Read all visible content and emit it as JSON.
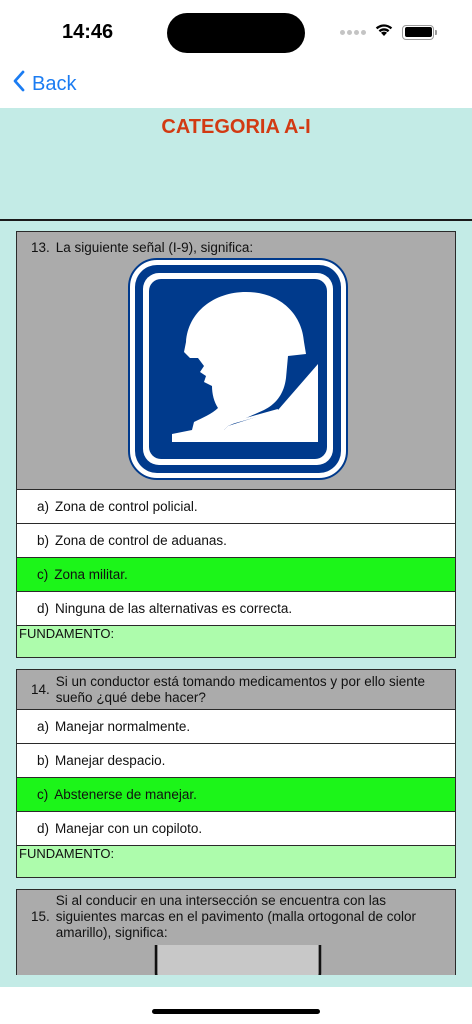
{
  "status": {
    "time": "14:46"
  },
  "nav": {
    "back_label": "Back"
  },
  "page": {
    "title": "CATEGORIA A-I"
  },
  "questions": [
    {
      "number": "13.",
      "text": "La siguiente señal (I-9), significa:",
      "options": [
        {
          "letter": "a)",
          "text": "Zona de control policial."
        },
        {
          "letter": "b)",
          "text": "Zona de control de aduanas."
        },
        {
          "letter": "c)",
          "text": "Zona militar."
        },
        {
          "letter": "d)",
          "text": "Ninguna de las alternativas es correcta."
        }
      ],
      "correct_option": "c",
      "fundamento": "FUNDAMENTO:"
    },
    {
      "number": "14.",
      "text": "Si un conductor está tomando medicamentos y por ello siente sueño ¿qué debe hacer?",
      "options": [
        {
          "letter": "a)",
          "text": "Manejar normalmente."
        },
        {
          "letter": "b)",
          "text": "Manejar despacio."
        },
        {
          "letter": "c)",
          "text": "Abstenerse de manejar."
        },
        {
          "letter": "d)",
          "text": "Manejar con un copiloto."
        }
      ],
      "correct_option": "c",
      "fundamento": "FUNDAMENTO:"
    },
    {
      "number": "15.",
      "text": "Si al conducir en una intersección se encuentra con las siguientes marcas en el pavimento (malla ortogonal de color amarillo), significa:"
    }
  ],
  "colors": {
    "accent": "#1b7cf2",
    "title": "#d23a12",
    "background": "#c3ebe6",
    "question_header": "#ababab",
    "correct": "#1cf519",
    "fundamento": "#adfcac",
    "sign_blue": "#003a8c"
  },
  "icons": {
    "back": "chevron-left-icon",
    "wifi": "wifi-icon",
    "battery": "battery-icon",
    "signal": "cellular-signal-icon"
  }
}
